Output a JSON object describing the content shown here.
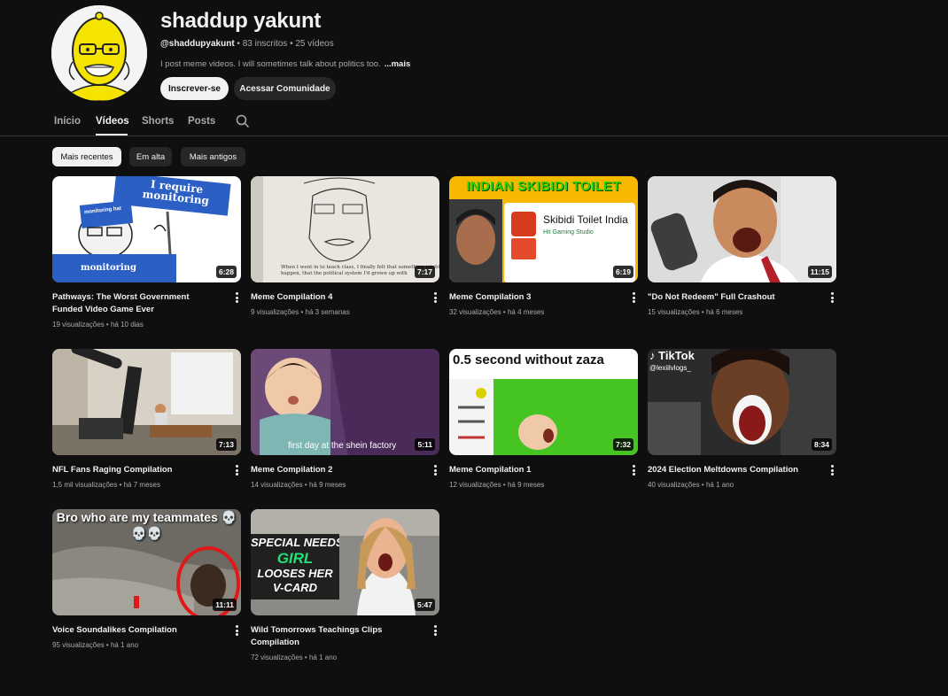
{
  "channel": {
    "name": "shaddup yakunt",
    "handle": "@shaddupyakunt",
    "stats": " • 83 inscritos • 25 vídeos",
    "description": "I post meme videos. I will sometimes talk about politics too.",
    "more_label": "...mais",
    "subscribe_label": "Inscrever-se",
    "community_label": "Acessar Comunidade"
  },
  "tabs": [
    "Início",
    "Vídeos",
    "Shorts",
    "Posts"
  ],
  "chips": [
    "Mais recentes",
    "Em alta",
    "Mais antigos"
  ],
  "videos": [
    {
      "title": "Pathways: The Worst Government Funded Video Game Ever",
      "meta": "19 visualizações • há 10 dias",
      "duration": "6:28",
      "thumb_text": "I require monitoring",
      "thumb_text2": "monitoring",
      "thumb_text3": "monitoring hat"
    },
    {
      "title": "Meme Compilation 4",
      "meta": "9 visualizações • há 3 semanas",
      "duration": "7:17",
      "thumb_text": "When I went in to teach class, I finally felt that something might happen, that the political system I'd grown up with"
    },
    {
      "title": "Meme Compilation 3",
      "meta": "32 visualizações • há 4 meses",
      "duration": "6:19",
      "thumb_text": "INDIAN SKIBIDI TOILET",
      "thumb_text2": "Skibidi Toilet India",
      "thumb_text3": "Hit Gaming Studio"
    },
    {
      "title": "\"Do Not Redeem\" Full Crashout",
      "meta": "15 visualizações • há 6 meses",
      "duration": "11:15"
    },
    {
      "title": "NFL Fans Raging Compilation",
      "meta": "1,5 mil visualizações • há 7 meses",
      "duration": "7:13"
    },
    {
      "title": "Meme Compilation 2",
      "meta": "14 visualizações • há 9 meses",
      "duration": "5:11",
      "thumb_text": "first day at the shein factory"
    },
    {
      "title": "Meme Compilation 1",
      "meta": "12 visualizações • há 9 meses",
      "duration": "7:32",
      "thumb_text": "0.5 second without zaza"
    },
    {
      "title": "2024 Election Meltdowns Compilation",
      "meta": "40 visualizações • há 1 ano",
      "duration": "8:34",
      "thumb_text": "TikTok",
      "thumb_text2": "@lexiilvlogs_"
    },
    {
      "title": "Voice Soundalikes Compilation",
      "meta": "95 visualizações • há 1 ano",
      "duration": "11:11",
      "thumb_text": "Bro who are my teammates 💀💀💀"
    },
    {
      "title": "Wild Tomorrows Teachings Clips Compilation",
      "meta": "72 visualizações • há 1 ano",
      "duration": "5:47",
      "thumb_text": "SPECIAL NEEDS",
      "thumb_text2": "GIRL",
      "thumb_text3": "LOOSES HER V-CARD"
    }
  ]
}
